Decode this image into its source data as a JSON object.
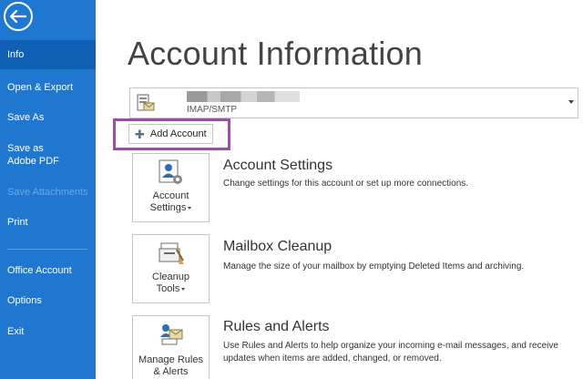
{
  "sidebar": {
    "items": [
      {
        "label": "Info"
      },
      {
        "label": "Open & Export"
      },
      {
        "label": "Save As"
      },
      {
        "label": "Save as Adobe PDF"
      },
      {
        "label": "Save Attachments"
      },
      {
        "label": "Print"
      },
      {
        "label": "Office Account"
      },
      {
        "label": "Options"
      },
      {
        "label": "Exit"
      }
    ]
  },
  "main": {
    "title": "Account Information",
    "account_selector": {
      "type": "IMAP/SMTP"
    },
    "add_account_label": "Add Account",
    "sections": [
      {
        "button_line1": "Account",
        "button_line2": "Settings",
        "title": "Account Settings",
        "description": "Change settings for this account or set up more connections."
      },
      {
        "button_line1": "Cleanup",
        "button_line2": "Tools",
        "title": "Mailbox Cleanup",
        "description": "Manage the size of your mailbox by emptying Deleted Items and archiving."
      },
      {
        "button_line1": "Manage Rules",
        "button_line2": "& Alerts",
        "title": "Rules and Alerts",
        "description": "Use Rules and Alerts to help organize your incoming e-mail messages, and receive updates when items are added, changed, or removed."
      }
    ]
  },
  "colors": {
    "sidebar": "#1f77d0",
    "sidebar_active": "#0f5fb5",
    "highlight": "#9b4ea6"
  },
  "icons": [
    "back-arrow-icon",
    "account-icon",
    "dropdown-arrow-icon",
    "plus-icon",
    "account-settings-icon",
    "cleanup-tools-icon",
    "rules-alerts-icon"
  ]
}
